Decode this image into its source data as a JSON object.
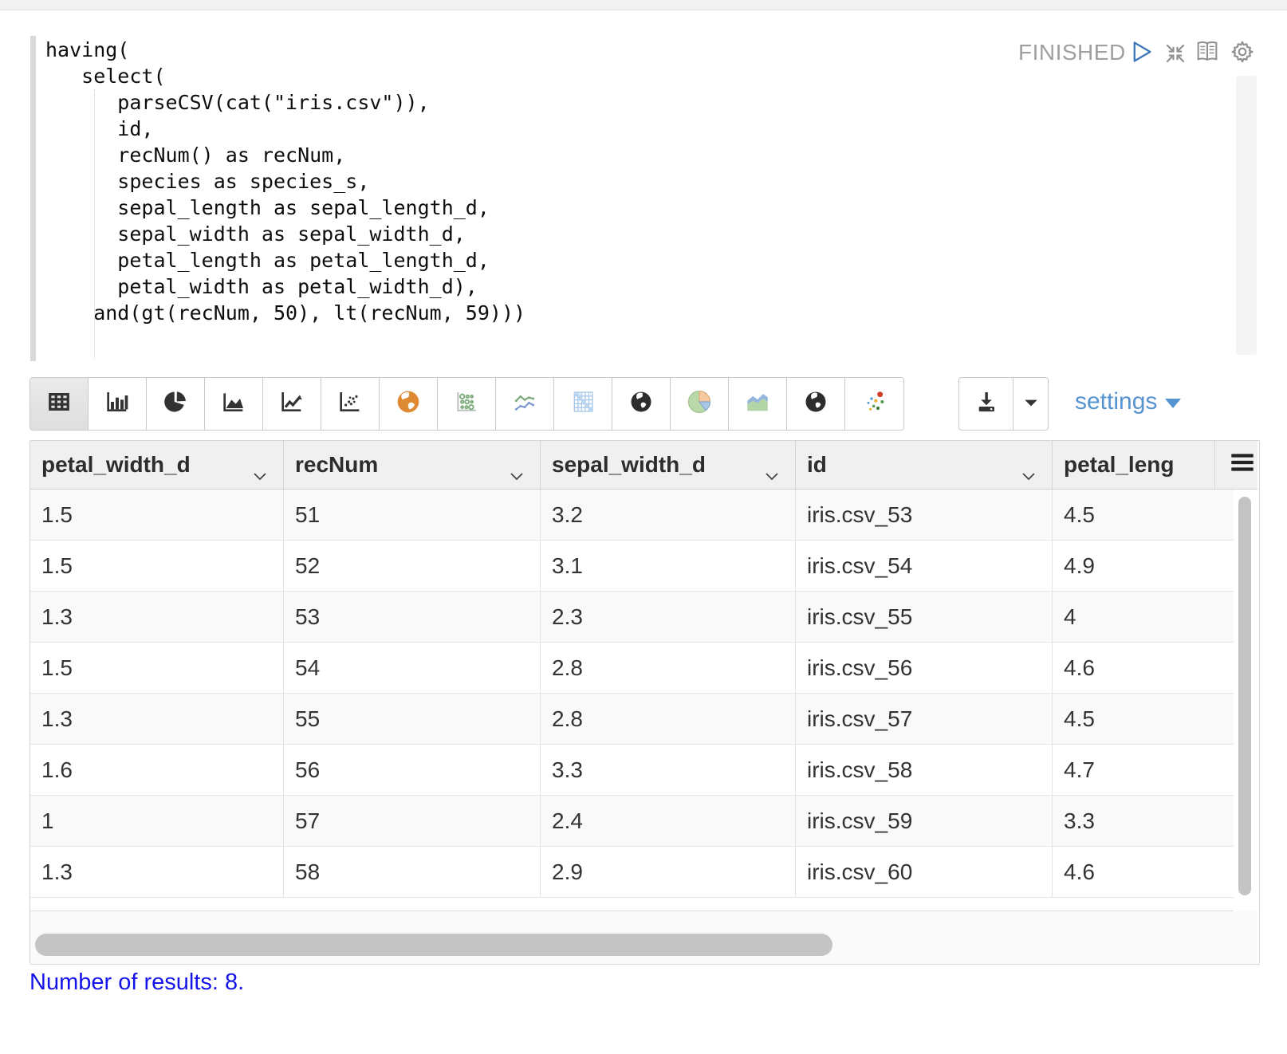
{
  "paragraph": {
    "status": "FINISHED",
    "controls": [
      "run-icon",
      "compress-icon",
      "book-icon",
      "gear-icon"
    ]
  },
  "editor": {
    "code": "having(\n   select(\n      parseCSV(cat(\"iris.csv\")),\n      id,\n      recNum() as recNum,\n      species as species_s,\n      sepal_length as sepal_length_d,\n      sepal_width as sepal_width_d,\n      petal_length as petal_length_d,\n      petal_width as petal_width_d),\n    and(gt(recNum, 50), lt(recNum, 59)))"
  },
  "toolbar": {
    "chart_buttons": [
      {
        "name": "table",
        "selected": true
      },
      {
        "name": "bar-chart",
        "selected": false
      },
      {
        "name": "pie-chart",
        "selected": false
      },
      {
        "name": "area-chart",
        "selected": false
      },
      {
        "name": "line-chart",
        "selected": false
      },
      {
        "name": "scatter-chart",
        "selected": false
      },
      {
        "name": "map",
        "selected": false
      },
      {
        "name": "bubble-matrix",
        "selected": false
      },
      {
        "name": "multi-line",
        "selected": false
      },
      {
        "name": "heatmap",
        "selected": false
      },
      {
        "name": "globe",
        "selected": false
      },
      {
        "name": "pie-colored",
        "selected": false
      },
      {
        "name": "area-colored",
        "selected": false
      },
      {
        "name": "globe-alt",
        "selected": false
      },
      {
        "name": "scatter-colored",
        "selected": false
      }
    ],
    "settings_label": "settings"
  },
  "table": {
    "columns": [
      {
        "label": "petal_width_d"
      },
      {
        "label": "recNum"
      },
      {
        "label": "sepal_width_d"
      },
      {
        "label": "id"
      },
      {
        "label": "petal_leng"
      }
    ],
    "rows": [
      [
        "1.5",
        "51",
        "3.2",
        "iris.csv_53",
        "4.5"
      ],
      [
        "1.5",
        "52",
        "3.1",
        "iris.csv_54",
        "4.9"
      ],
      [
        "1.3",
        "53",
        "2.3",
        "iris.csv_55",
        "4"
      ],
      [
        "1.5",
        "54",
        "2.8",
        "iris.csv_56",
        "4.6"
      ],
      [
        "1.3",
        "55",
        "2.8",
        "iris.csv_57",
        "4.5"
      ],
      [
        "1.6",
        "56",
        "3.3",
        "iris.csv_58",
        "4.7"
      ],
      [
        "1",
        "57",
        "2.4",
        "iris.csv_59",
        "3.3"
      ],
      [
        "1.3",
        "58",
        "2.9",
        "iris.csv_60",
        "4.6"
      ]
    ]
  },
  "footer": {
    "results_text": "Number of results: 8."
  },
  "colors": {
    "status_gray": "#9f9f9f",
    "icon_gray": "#8f8f8f",
    "run_blue": "#3c76b8",
    "settings_blue": "#5693d1",
    "results_blue": "#1414ea",
    "header_bg": "#f0f0f0",
    "odd_row_bg": "#f9f9f9",
    "border": "#d5d5d5",
    "scrollbar_thumb": "#c4c4c4"
  }
}
